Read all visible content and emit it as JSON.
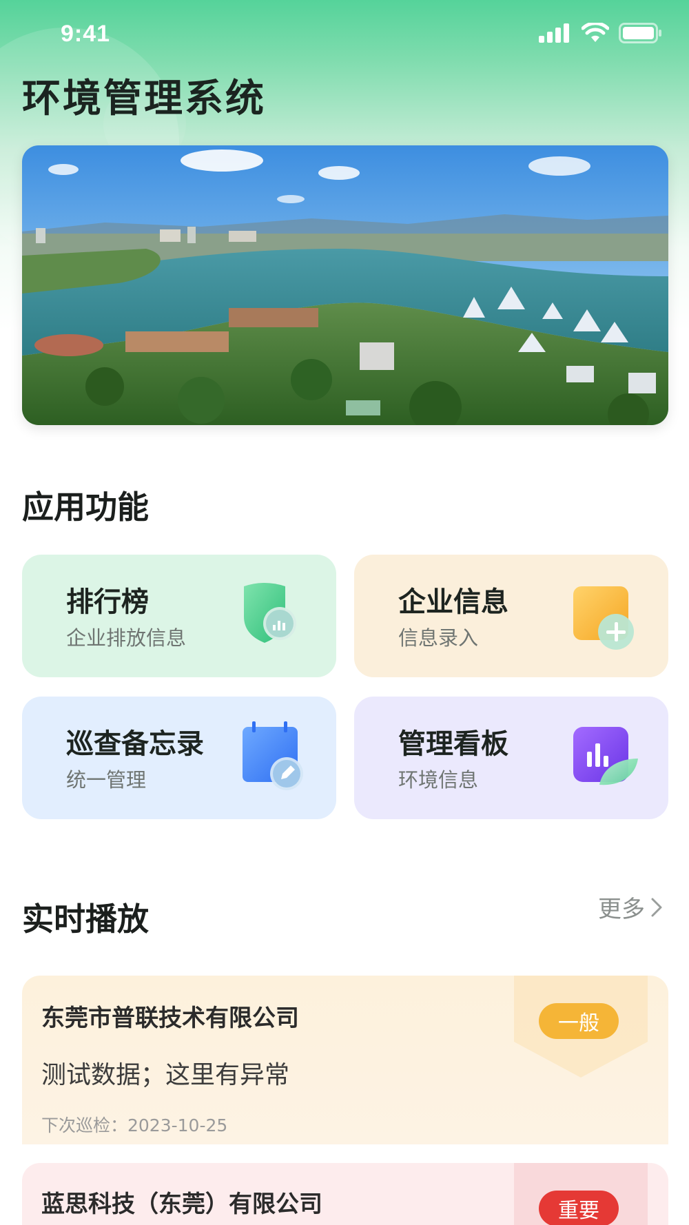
{
  "status_bar": {
    "time": "9:41"
  },
  "header": {
    "title": "环境管理系统"
  },
  "banner": {
    "image": "aerial-lake-city-landscape"
  },
  "features": {
    "title": "应用功能",
    "items": [
      {
        "title": "排行榜",
        "subtitle": "企业排放信息",
        "icon": "shield-chart-icon",
        "bg": "#dcf5e6"
      },
      {
        "title": "企业信息",
        "subtitle": "信息录入",
        "icon": "folder-add-icon",
        "bg": "#fbefdb"
      },
      {
        "title": "巡查备忘录",
        "subtitle": "统一管理",
        "icon": "calendar-edit-icon",
        "bg": "#e2eefe"
      },
      {
        "title": "管理看板",
        "subtitle": "环境信息",
        "icon": "dashboard-leaf-icon",
        "bg": "#ebe9fd"
      }
    ]
  },
  "realtime": {
    "title": "实时播放",
    "more_label": "更多",
    "items": [
      {
        "company": "东莞市普联技术有限公司",
        "description": "测试数据；这里有异常",
        "date": "下次巡检：2023-10-25",
        "tag": "一般",
        "tag_color": "#f5b537"
      },
      {
        "company": "蓝思科技（东莞）有限公司",
        "tag": "重要",
        "tag_color": "#e53935"
      }
    ]
  }
}
